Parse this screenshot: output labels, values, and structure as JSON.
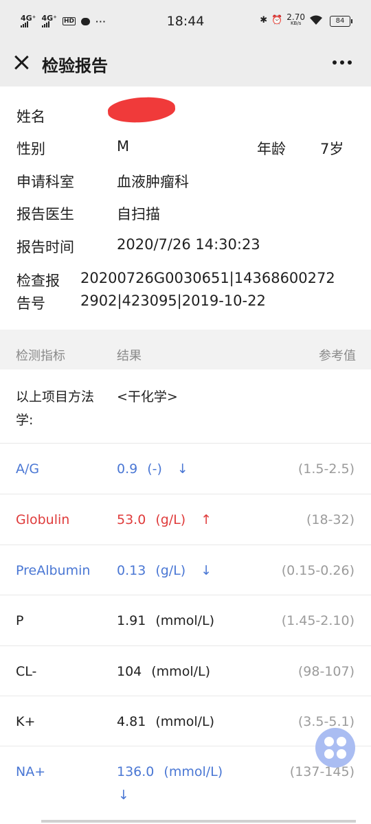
{
  "status_bar": {
    "signal1": "4G⁺",
    "signal2": "4G⁺",
    "hd": "HD",
    "time": "18:44",
    "speed_value": "2.70",
    "speed_unit": "KB/s",
    "battery": "84"
  },
  "nav": {
    "title": "检验报告"
  },
  "patient": {
    "name_label": "姓名",
    "gender_label": "性别",
    "gender": "M",
    "age_label": "年龄",
    "age": "7岁",
    "department_label": "申请科室",
    "department": "血液肿瘤科",
    "doctor_label": "报告医生",
    "doctor": "自扫描",
    "time_label": "报告时间",
    "time": "2020/7/26 14:30:23",
    "report_no_label_1": "检查报",
    "report_no_label_2": "告号",
    "report_no_line1": "20200726G0030651|14368600272",
    "report_no_line2": "2902|423095|2019-10-22"
  },
  "table": {
    "col_indicator": "检测指标",
    "col_result": "结果",
    "col_reference": "参考值",
    "method_label_1": "以上项目方法",
    "method_label_2": "学:",
    "method_value": "<干化学>",
    "rows": [
      {
        "name": "A/G",
        "value": "0.9",
        "unit": "(-)",
        "arrow": "↓",
        "ref": "(1.5-2.5)",
        "status": "low"
      },
      {
        "name": "Globulin",
        "value": "53.0",
        "unit": "(g/L)",
        "arrow": "↑",
        "ref": "(18-32)",
        "status": "high"
      },
      {
        "name": "PreAlbumin",
        "value": "0.13",
        "unit": "(g/L)",
        "arrow": "↓",
        "ref": "(0.15-0.26)",
        "status": "low"
      },
      {
        "name": "P",
        "value": "1.91",
        "unit": "(mmol/L)",
        "arrow": "",
        "ref": "(1.45-2.10)",
        "status": "normal"
      },
      {
        "name": "CL-",
        "value": "104",
        "unit": "(mmol/L)",
        "arrow": "",
        "ref": "(98-107)",
        "status": "normal"
      },
      {
        "name": "K+",
        "value": "4.81",
        "unit": "(mmol/L)",
        "arrow": "",
        "ref": "(3.5-5.1)",
        "status": "normal"
      },
      {
        "name": "NA+",
        "value": "136.0",
        "unit": "(mmol/L)",
        "arrow": "↓",
        "ref": "(137-145)",
        "status": "low"
      }
    ]
  },
  "colors": {
    "low": "#4a77d4",
    "high": "#df3b3b",
    "normal": "#1f1f1f",
    "redaction": "#f03a3a"
  },
  "icons": {
    "close": "close-icon",
    "more": "more-icon",
    "floating": "floating-menu-icon"
  }
}
